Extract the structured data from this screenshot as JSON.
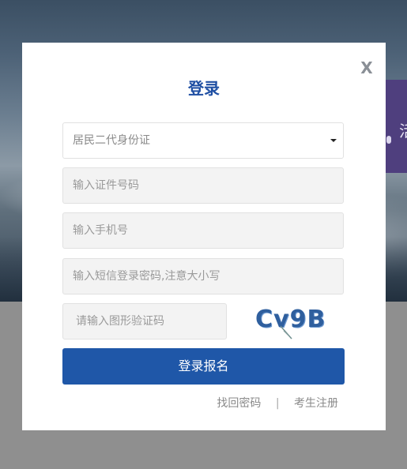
{
  "modal": {
    "close_label": "X",
    "title": "登录",
    "id_type_selected": "居民二代身份证",
    "id_number_placeholder": "输入证件号码",
    "phone_placeholder": "输入手机号",
    "password_placeholder": "输入短信登录密码,注意大小写",
    "captcha_placeholder": "请输入图形验证码",
    "captcha_text": "Cv9B",
    "submit_label": "登录报名",
    "forgot_password_link": "找回密码",
    "separator": "|",
    "register_link": "考生注册"
  },
  "background": {
    "banner_text": "活"
  },
  "colors": {
    "brand": "#1f57a8",
    "title": "#1f4fa3",
    "input_bg": "#f3f3f3",
    "banner": "#4f3f7e"
  }
}
